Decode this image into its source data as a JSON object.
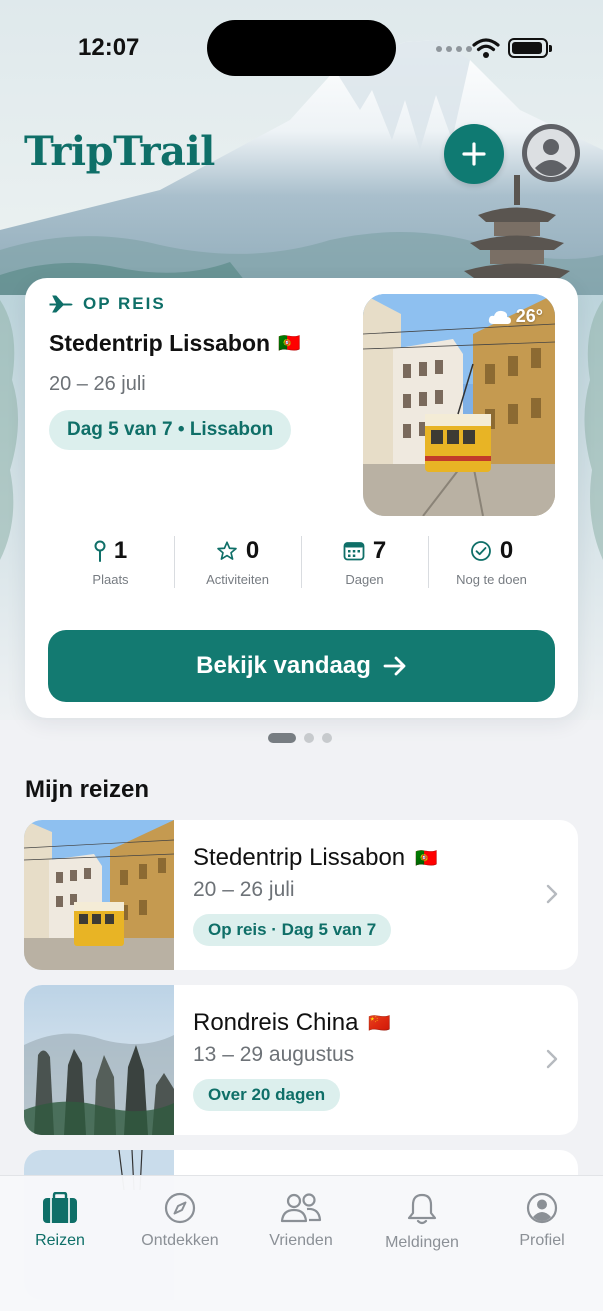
{
  "status_bar": {
    "time": "12:07"
  },
  "header": {
    "logo": "TripTrail",
    "add_icon": "plus-icon",
    "profile_icon": "person-icon"
  },
  "featured": {
    "badge": "OP REIS",
    "title": "Stedentrip Lissabon",
    "flag": "🇵🇹",
    "dates": "20 – 26 juli",
    "day_pill": "Dag 5 van 7 • Lissabon",
    "weather_temp": "26°",
    "stats": [
      {
        "value": "1",
        "label": "Plaats",
        "icon": "pin-icon"
      },
      {
        "value": "0",
        "label": "Activiteiten",
        "icon": "star-icon"
      },
      {
        "value": "7",
        "label": "Dagen",
        "icon": "calendar-icon"
      },
      {
        "value": "0",
        "label": "Nog te doen",
        "icon": "check-circle-icon"
      }
    ],
    "cta": "Bekijk vandaag",
    "page_index": 1,
    "page_count": 3
  },
  "section": {
    "title": "Mijn reizen"
  },
  "trips": [
    {
      "name": "Stedentrip Lissabon",
      "flag": "🇵🇹",
      "dates": "20 – 26 juli",
      "pill": "Op reis · Dag 5 van 7"
    },
    {
      "name": "Rondreis China",
      "flag": "🇨🇳",
      "dates": "13 – 29 augustus",
      "pill": "Over 20 dagen"
    }
  ],
  "tabs": [
    {
      "label": "Reizen",
      "icon": "suitcase-icon",
      "active": true
    },
    {
      "label": "Ontdekken",
      "icon": "compass-icon",
      "active": false
    },
    {
      "label": "Vrienden",
      "icon": "people-icon",
      "active": false
    },
    {
      "label": "Meldingen",
      "icon": "bell-icon",
      "active": false
    },
    {
      "label": "Profiel",
      "icon": "profile-icon",
      "active": false
    }
  ],
  "colors": {
    "brand": "#0f6f68",
    "button": "#137a71",
    "pill_bg": "#dcefed"
  }
}
